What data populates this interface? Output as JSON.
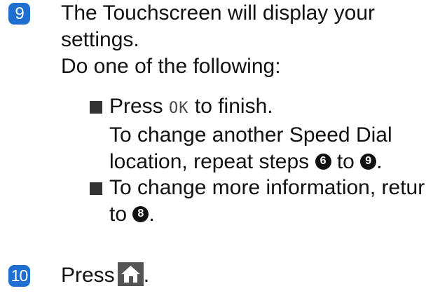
{
  "colors": {
    "badge": "#1f6fd1",
    "bullet": "#333333",
    "home_icon_bg": "#555555"
  },
  "step9": {
    "number": "9",
    "line1": "The Touchscreen will display your",
    "line2": "settings.",
    "line3": "Do one of the following:"
  },
  "bullets": [
    {
      "press_prefix": "Press ",
      "key": "OK",
      "press_suffix": " to finish.",
      "line2": "To change another Speed Dial",
      "line3_prefix": "location, repeat steps ",
      "from_step": "6",
      "line3_mid": " to ",
      "to_step": "9",
      "line3_suffix": "."
    },
    {
      "line1": "To change more information, return",
      "line2_prefix": "to ",
      "target_step": "8",
      "line2_suffix": "."
    }
  ],
  "step10": {
    "number": "10",
    "label": "Press",
    "suffix": ".",
    "icon": "home-icon"
  }
}
